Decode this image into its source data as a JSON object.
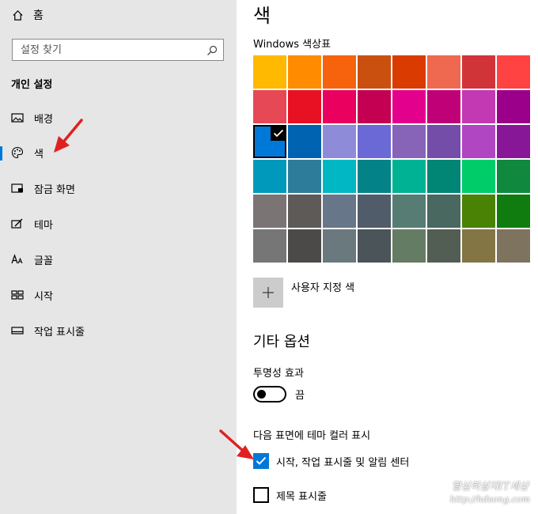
{
  "sidebar": {
    "home_label": "홈",
    "search_placeholder": "설정 찾기",
    "section_title": "개인 설정",
    "items": [
      {
        "label": "배경",
        "icon": "picture-icon",
        "selected": false
      },
      {
        "label": "색",
        "icon": "palette-icon",
        "selected": true
      },
      {
        "label": "잠금 화면",
        "icon": "lock-screen-icon",
        "selected": false
      },
      {
        "label": "테마",
        "icon": "theme-icon",
        "selected": false
      },
      {
        "label": "글꼴",
        "icon": "font-icon",
        "selected": false
      },
      {
        "label": "시작",
        "icon": "start-icon",
        "selected": false
      },
      {
        "label": "작업 표시줄",
        "icon": "taskbar-icon",
        "selected": false
      }
    ]
  },
  "main": {
    "page_title": "색",
    "palette_title": "Windows 색상표",
    "palette": [
      "#ffb900",
      "#ff8c00",
      "#f7630c",
      "#ca5010",
      "#da3b01",
      "#ef6950",
      "#d13438",
      "#ff4343",
      "#e74856",
      "#e81123",
      "#ea005e",
      "#c30052",
      "#e3008c",
      "#bf0077",
      "#c239b3",
      "#9a0089",
      "#0078d7",
      "#0063b1",
      "#8e8cd8",
      "#6b69d6",
      "#8764b8",
      "#744da9",
      "#b146c2",
      "#881798",
      "#0099bc",
      "#2d7d9a",
      "#00b7c3",
      "#038387",
      "#00b294",
      "#018574",
      "#00cc6a",
      "#10893e",
      "#7a7574",
      "#5d5a58",
      "#68768a",
      "#515c6b",
      "#567c73",
      "#486860",
      "#498205",
      "#107c10",
      "#767676",
      "#4c4a48",
      "#69797e",
      "#4a5459",
      "#647c64",
      "#525e54",
      "#847545",
      "#7e735f"
    ],
    "selected_swatch": 16,
    "custom_color_label": "사용자 지정 색",
    "other_options_title": "기타 옵션",
    "transparency_label": "투명성 효과",
    "transparency_state": "끔",
    "transparency_on": false,
    "surfaces_label": "다음 표면에 테마 컬러 표시",
    "checkboxes": [
      {
        "label": "시작, 작업 표시줄 및 알림 센터",
        "checked": true
      },
      {
        "label": "제목 표시줄",
        "checked": false
      }
    ]
  },
  "watermark": {
    "line1": "열심히살자IT세상",
    "line2": "http://hdsong.com"
  },
  "colors": {
    "accent": "#0078d7",
    "sidebar_bg": "#e6e6e6",
    "annotation_arrow": "#e02020"
  }
}
